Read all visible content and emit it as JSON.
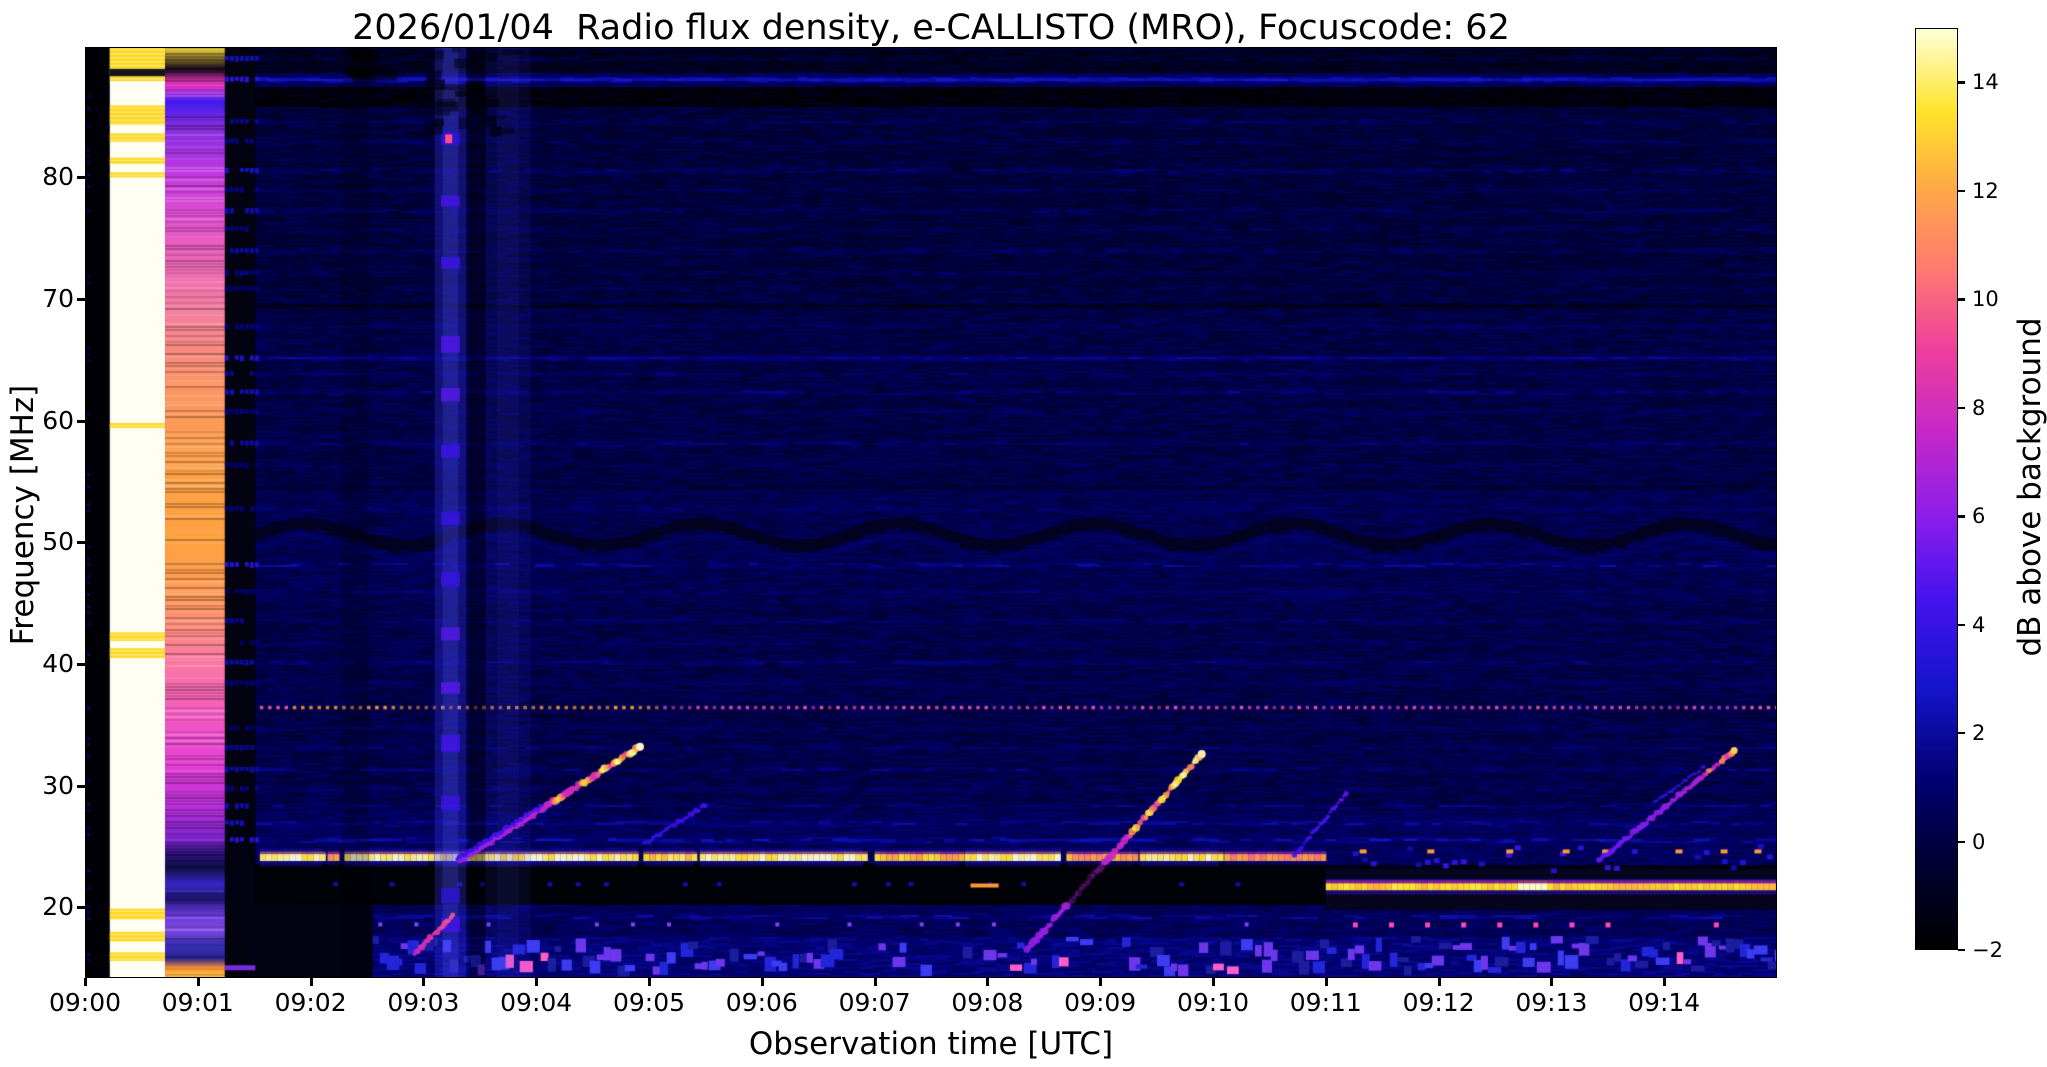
{
  "chart_data": {
    "type": "heatmap",
    "title": "2026/01/04  Radio flux density, e-CALLISTO (MRO), Focuscode: 62",
    "xlabel": "Observation time [UTC]",
    "ylabel": "Frequency [MHz]",
    "x_tick_labels": [
      "09:00",
      "09:01",
      "09:02",
      "09:03",
      "09:04",
      "09:05",
      "09:06",
      "09:07",
      "09:08",
      "09:09",
      "09:10",
      "09:11",
      "09:12",
      "09:13",
      "09:14"
    ],
    "x_tick_minutes": [
      0,
      1,
      2,
      3,
      4,
      5,
      6,
      7,
      8,
      9,
      10,
      11,
      12,
      13,
      14
    ],
    "x_range_minutes": [
      0,
      15
    ],
    "y_tick_values": [
      20,
      30,
      40,
      50,
      60,
      70,
      80
    ],
    "y_range_mhz": [
      14.2,
      90.7
    ],
    "grid": false,
    "colorbar": {
      "label": "dB above background",
      "tick_values": [
        14,
        12,
        10,
        8,
        6,
        4,
        2,
        0,
        -2
      ],
      "tick_labels": [
        "14",
        "12",
        "10",
        "8",
        "6",
        "4",
        "2",
        "0",
        "−2"
      ],
      "value_range": [
        -2,
        15.0
      ],
      "colormap": "gnuplot2-like (black-blue-violet-magenta-orange-yellow-white)",
      "colormap_stops": [
        [
          "0.00",
          "#000000"
        ],
        [
          "0.09",
          "#000030"
        ],
        [
          "0.18",
          "#00006e"
        ],
        [
          "0.28",
          "#1414c8"
        ],
        [
          "0.38",
          "#4513ee"
        ],
        [
          "0.47",
          "#8c1eea"
        ],
        [
          "0.56",
          "#c428c8"
        ],
        [
          "0.65",
          "#ee3e9e"
        ],
        [
          "0.74",
          "#ff7a70"
        ],
        [
          "0.83",
          "#ffab45"
        ],
        [
          "0.91",
          "#ffe32a"
        ],
        [
          "1.00",
          "#ffffd8"
        ]
      ]
    },
    "background_model": {
      "profile_db": [
        [
          14.2,
          17.6,
          1.2
        ],
        [
          17.6,
          20.3,
          0.55
        ],
        [
          20.3,
          23.6,
          -1.4
        ],
        [
          23.6,
          28,
          0.6
        ],
        [
          28,
          45,
          0.15
        ],
        [
          45,
          55,
          0.32
        ],
        [
          55,
          70,
          0.05
        ],
        [
          70,
          85.8,
          -0.2
        ],
        [
          85.8,
          87.5,
          -1.6
        ],
        [
          87.5,
          88.6,
          0.5
        ],
        [
          88.6,
          90.7,
          -1.0
        ]
      ],
      "noise_db": 0.55,
      "stripes": [
        [
          89.8,
          1.3,
          1
        ],
        [
          88.1,
          2.4,
          0
        ],
        [
          84.6,
          1.0,
          1
        ],
        [
          83.0,
          0.8,
          1
        ],
        [
          80.6,
          1.4,
          1
        ],
        [
          79.0,
          0.8,
          1
        ],
        [
          77.3,
          1.2,
          1
        ],
        [
          75.8,
          0.7,
          1
        ],
        [
          74.0,
          1.1,
          1
        ],
        [
          72.2,
          0.8,
          1
        ],
        [
          70.9,
          0.6,
          1
        ],
        [
          69.5,
          -1.2,
          0
        ],
        [
          67.8,
          0.7,
          1
        ],
        [
          65.2,
          1.6,
          0
        ],
        [
          63.9,
          0.9,
          1
        ],
        [
          62.4,
          1.3,
          1
        ],
        [
          60.8,
          0.7,
          1
        ],
        [
          58.2,
          1.1,
          1
        ],
        [
          56.4,
          0.6,
          1
        ],
        [
          54.6,
          -0.9,
          0
        ],
        [
          52.8,
          0.7,
          1
        ],
        [
          48.2,
          1.7,
          1
        ],
        [
          46.0,
          0.6,
          1
        ],
        [
          43.6,
          0.9,
          1
        ],
        [
          41.8,
          0.6,
          1
        ],
        [
          40.2,
          1.1,
          1
        ],
        [
          38.5,
          0.7,
          1
        ],
        [
          34.8,
          0.6,
          1
        ],
        [
          33.2,
          0.9,
          1
        ],
        [
          31.4,
          1.1,
          1
        ],
        [
          29.8,
          0.8,
          1
        ],
        [
          28.4,
          1.2,
          1
        ],
        [
          27.0,
          1.3,
          1
        ],
        [
          25.6,
          1.8,
          1
        ],
        [
          19.3,
          1.6,
          1
        ]
      ],
      "data_start_minute": 1.51
    },
    "features": {
      "left_columns": {
        "edge_black": {
          "t": [
            0,
            0.22
          ]
        },
        "saturated_white": {
          "t": [
            0.22,
            0.71
          ],
          "color": "#fffef2",
          "stripe_color": "#ffd820",
          "yellow_stripes": [
            [
              90.7,
              88.9
            ],
            [
              88.3,
              87.9
            ],
            [
              85.9,
              84.3
            ],
            [
              83.6,
              82.9
            ],
            [
              81.6,
              81.1
            ],
            [
              80.4,
              80.0
            ],
            [
              59.8,
              59.4
            ],
            [
              42.6,
              41.9
            ],
            [
              41.3,
              40.5
            ],
            [
              19.9,
              19.0
            ],
            [
              18.0,
              17.2
            ],
            [
              16.3,
              15.6
            ]
          ],
          "black_band": [
            88.9,
            88.3
          ]
        },
        "warm_column": {
          "t": [
            0.71,
            1.24
          ],
          "gradient": [
            [
              90.7,
              "#ffe23c"
            ],
            [
              88.9,
              "#120617"
            ],
            [
              87.6,
              "#ff3fd0"
            ],
            [
              86.2,
              "#3f1bee"
            ],
            [
              84.5,
              "#7d2ce2"
            ],
            [
              80.0,
              "#c63ae0"
            ],
            [
              75.0,
              "#e95bc4"
            ],
            [
              69.0,
              "#f47fa0"
            ],
            [
              63.0,
              "#fb9465"
            ],
            [
              56.0,
              "#ffa148"
            ],
            [
              50.0,
              "#ffa240"
            ],
            [
              45.5,
              "#ff9b59"
            ],
            [
              41.0,
              "#fb7f9a"
            ],
            [
              36.0,
              "#f55cc0"
            ],
            [
              31.5,
              "#e33ed6"
            ],
            [
              28.0,
              "#b32fd9"
            ],
            [
              25.6,
              "#7a22c9"
            ],
            [
              24.3,
              "#2a1178"
            ],
            [
              23.2,
              "#111048"
            ],
            [
              21.9,
              "#3726c9"
            ],
            [
              20.8,
              "#1b1670"
            ],
            [
              19.6,
              "#6337d6"
            ],
            [
              18.2,
              "#8148e2"
            ],
            [
              16.9,
              "#3a30bb"
            ],
            [
              15.8,
              "#2a2390"
            ],
            [
              15.0,
              "#ff9833"
            ],
            [
              14.2,
              "#ffc94a"
            ]
          ]
        },
        "dark_column": {
          "t": [
            1.24,
            1.51
          ],
          "color": "#020210",
          "blue_boost": 1.9
        }
      },
      "vertical_bands": [
        {
          "t": [
            3.1,
            3.38
          ],
          "amp": 1.6,
          "knot_fs": [
            83.2,
            78,
            73,
            66.5,
            62,
            57.5,
            52,
            47,
            42.5,
            38,
            33.5,
            28.5,
            21,
            18.5
          ],
          "pink_dot": {
            "t": 3.22,
            "f": 83.2,
            "color": "#ff4f8e"
          }
        },
        {
          "t": [
            3.4,
            3.55
          ],
          "amp": -0.9
        },
        {
          "t": [
            3.55,
            3.95
          ],
          "amp": 0.55
        },
        {
          "t": [
            2.28,
            2.52
          ],
          "amp": -0.5
        }
      ],
      "top_dark_smudges": [
        {
          "t": [
            3.0,
            3.75
          ],
          "f": [
            83.8,
            90.7
          ]
        },
        {
          "t": [
            2.3,
            2.55
          ],
          "f": [
            88.6,
            90.7
          ]
        }
      ],
      "dotted_line": {
        "f": 36.4,
        "t": [
          1.55,
          15
        ],
        "spacing_min": 0.073,
        "bright_t": [
          1.8,
          5.1
        ],
        "bright_color": "#ff9b3c",
        "dim_color": "#e050b0"
      },
      "wavy_dark_lane": {
        "f_center": 50.7,
        "amp_mhz": 0.9,
        "period_min": 1.75,
        "t": [
          1.51,
          15
        ]
      },
      "black_lane": {
        "f": [
          20.3,
          23.6
        ],
        "t": [
          1.2,
          11.0
        ],
        "blue_dot_times": [
          2.2,
          2.7,
          3.3,
          3.5,
          4.1,
          4.35,
          4.6,
          5.3,
          5.6,
          6.8,
          7.1,
          7.3,
          8.0,
          8.3,
          9.7,
          10.2
        ],
        "orange_dash": {
          "t": [
            7.85,
            8.1
          ],
          "f": 21.8,
          "color": "#ff9a35"
        }
      },
      "bottom_blank": {
        "t": [
          1.51,
          2.55
        ],
        "f": [
          14.2,
          20.3
        ]
      },
      "rfi_band_24": {
        "f": 24.1,
        "t": [
          1.51,
          11.0
        ],
        "core_color": "#ffd23a",
        "segments": [
          [
            1.55,
            2.1,
            1
          ],
          [
            2.15,
            2.25,
            0.5
          ],
          [
            2.3,
            3.05,
            0.95
          ],
          [
            3.1,
            4.9,
            1
          ],
          [
            4.95,
            5.4,
            0.8
          ],
          [
            5.45,
            6.9,
            1
          ],
          [
            7.0,
            7.75,
            0.7
          ],
          [
            7.8,
            8.65,
            1
          ],
          [
            8.7,
            9.3,
            0.55
          ],
          [
            9.35,
            10.05,
            0.95
          ],
          [
            10.1,
            11.0,
            0.45
          ]
        ]
      },
      "rfi_band_21_7": {
        "f": 21.7,
        "t": [
          11.0,
          15
        ],
        "core_color": "#ffd23a",
        "white_spot_t": 12.8,
        "upper_patch": {
          "f": [
            23.2,
            25.2
          ],
          "orange_dot_times": [
            11.3,
            11.9,
            12.6,
            13.1,
            13.45,
            14.1,
            14.5,
            14.8
          ]
        }
      },
      "pink_dot_row": {
        "f": 18.6,
        "t": [
          2.6,
          15
        ],
        "spacing_min": 0.32,
        "dim_color": "#7e46e8",
        "bright_color": "#ff49b8",
        "bright_after_t": 10.9
      },
      "bottom_mosaic": {
        "f": [
          14.3,
          17.7
        ],
        "density_segments": [
          [
            2.55,
            6.6,
            0.8
          ],
          [
            6.6,
            8.2,
            0.38
          ],
          [
            8.2,
            10.45,
            0.6
          ],
          [
            10.45,
            15,
            0.9
          ]
        ],
        "colors": [
          "#2326d8",
          "#3c3cf0",
          "#6c37ea",
          "#1b1c9e"
        ],
        "accent": "#ff5fc8"
      },
      "type_iii_bursts": [
        {
          "t": [
            3.32,
            4.92
          ],
          "f": [
            23.8,
            33.2
          ],
          "w": 3.0,
          "bright": 1.0,
          "knots": [
            0.55,
            0.7,
            0.8,
            0.88,
            0.96
          ],
          "tip": "#fff3c8"
        },
        {
          "t": [
            3.3,
            4.05
          ],
          "f": [
            24.0,
            28.3
          ],
          "w": 2.0,
          "bright": 0.35
        },
        {
          "t": [
            2.92,
            3.26
          ],
          "f": [
            16.2,
            19.3
          ],
          "w": 2.5,
          "bright": 0.8,
          "pink": true
        },
        {
          "t": [
            8.35,
            9.9
          ],
          "f": [
            16.5,
            32.6
          ],
          "w": 3.0,
          "bright": 1.0,
          "knots": [
            0.62,
            0.7,
            0.78,
            0.85,
            0.9,
            0.97
          ],
          "tip": "#ffe9a8"
        },
        {
          "t": [
            10.72,
            11.18
          ],
          "f": [
            24.3,
            29.3
          ],
          "w": 2.0,
          "bright": 0.4
        },
        {
          "t": [
            4.95,
            5.5
          ],
          "f": [
            25.2,
            28.4
          ],
          "w": 2.0,
          "bright": 0.3
        },
        {
          "t": [
            13.42,
            14.62
          ],
          "f": [
            23.8,
            32.9
          ],
          "w": 2.5,
          "bright": 0.75,
          "knots": [
            0.82,
            0.92,
            0.99
          ],
          "tip": "#ffcf60"
        },
        {
          "t": [
            13.9,
            14.35
          ],
          "f": [
            28.5,
            31.5
          ],
          "w": 1.5,
          "bright": 0.3
        }
      ]
    }
  }
}
